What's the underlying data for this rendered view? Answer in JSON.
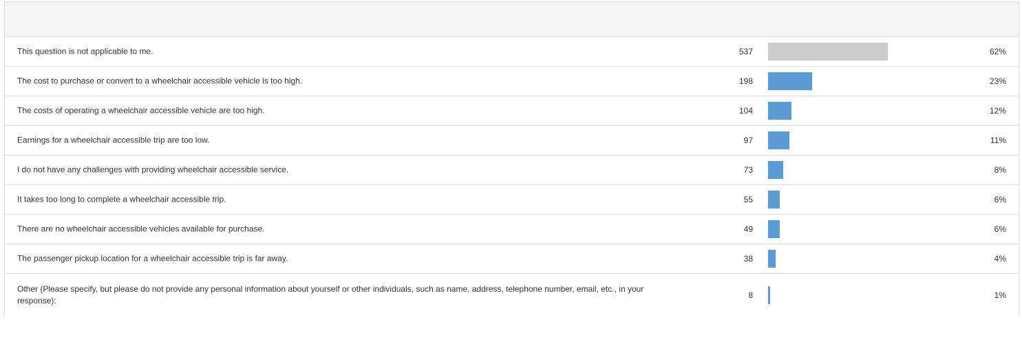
{
  "colors": {
    "bar_default": "#5b9bd5",
    "bar_not_applicable": "#cccccc",
    "header_background": "#f5f5f5",
    "border": "#dddddd"
  },
  "chart_data": {
    "type": "bar",
    "orientation": "horizontal",
    "title": "",
    "xlabel": "",
    "ylabel": "",
    "xlim": [
      0,
      100
    ],
    "categories": [
      "This question is not applicable to me.",
      "The cost to purchase or convert to a wheelchair accessible vehicle is too high.",
      "The costs of operating a wheelchair accessible vehicle are too high.",
      "Earnings for a wheelchair accessible trip are too low.",
      "I do not have any challenges with providing wheelchair accessible service.",
      "It takes too long to complete a wheelchair accessible trip.",
      "There are no wheelchair accessible vehicles available for purchase.",
      "The passenger pickup location for a wheelchair accessible trip is far away.",
      "Other (Please specify, but please do not provide any personal information about yourself or other individuals, such as name, address, telephone number, email, etc., in your response):"
    ],
    "counts": [
      "537",
      "198",
      "104",
      "97",
      "73",
      "55",
      "49",
      "38",
      "8"
    ],
    "values": [
      62,
      23,
      12,
      11,
      8,
      6,
      6,
      4,
      1
    ],
    "value_labels": [
      "62%",
      "23%",
      "12%",
      "11%",
      "8%",
      "6%",
      "6%",
      "4%",
      "1%"
    ],
    "bar_colors": [
      "#cccccc",
      "#5b9bd5",
      "#5b9bd5",
      "#5b9bd5",
      "#5b9bd5",
      "#5b9bd5",
      "#5b9bd5",
      "#5b9bd5",
      "#5b9bd5"
    ],
    "grid": false,
    "legend": "none"
  }
}
